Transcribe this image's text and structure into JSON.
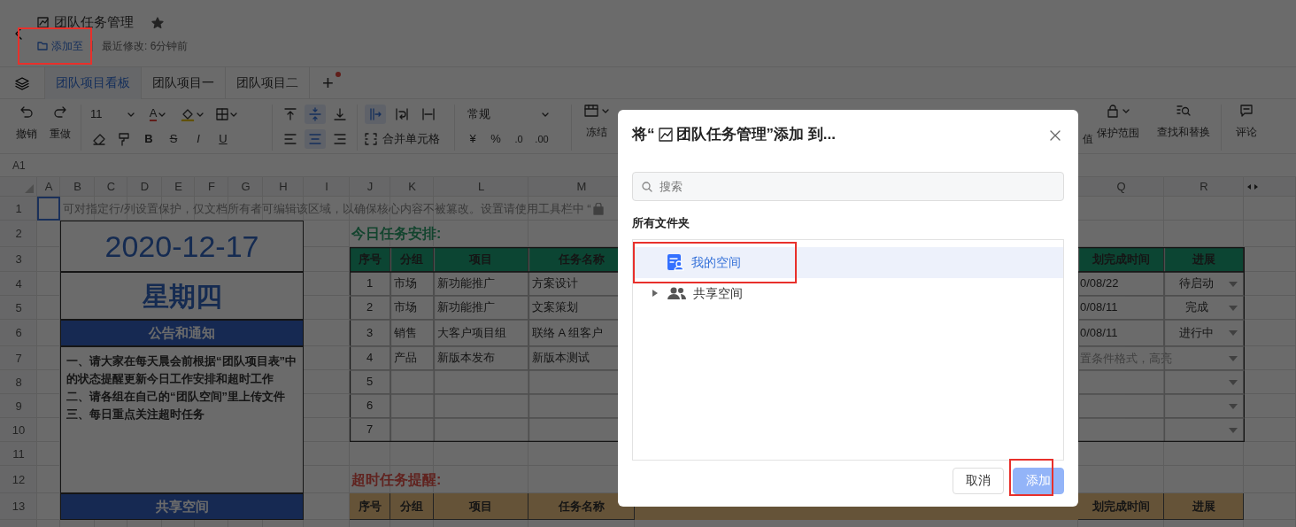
{
  "document": {
    "title": "团队任务管理",
    "starred": true,
    "add_to": {
      "label": "添加至",
      "highlighted": true
    },
    "last_modified": "最近修改: 6分钟前"
  },
  "sheet_tabs": [
    {
      "label": "团队项目看板",
      "selected": true
    },
    {
      "label": "团队项目一",
      "selected": false
    },
    {
      "label": "团队项目二",
      "selected": false
    }
  ],
  "new_tab": {
    "label": "+",
    "has_notice": true
  },
  "toolbar": {
    "undo": "撤销",
    "redo": "重做",
    "font_size": "11",
    "font_color": "A",
    "bold": "B",
    "strikethrough": "S",
    "italic": "I",
    "underline": "U",
    "align_top_on": false,
    "align_middle_on": true,
    "align_bottom_on": false,
    "align_left_on": false,
    "align_center_on": true,
    "align_right_on": false,
    "overflow_on": true,
    "wrap_on": false,
    "clip_on": false,
    "merge_cells": "合并单元格",
    "number_format": "常规",
    "currency": "¥",
    "percent": "%",
    "decrease_decimals": ".0",
    "increase_decimals": ".00",
    "freeze": "冻结",
    "value_cut": "值",
    "protect_range": "保护范围",
    "find_replace": "查找和替换",
    "comment": "评论"
  },
  "name_box": "A1",
  "columns": [
    "A",
    "B",
    "C",
    "D",
    "E",
    "F",
    "G",
    "H",
    "I",
    "J",
    "K",
    "L",
    "M",
    "Q",
    "R"
  ],
  "rows": [
    "1",
    "2",
    "3",
    "4",
    "5",
    "6",
    "7",
    "8",
    "9",
    "10",
    "11",
    "12",
    "13"
  ],
  "sheet": {
    "notice": "可对指定行/列设置保护，仅文档所有者可编辑该区域，以确保核心内容不被篡改。设置请使用工具栏中 “",
    "date": "2020-12-17",
    "weekday": "星期四",
    "announcement_heading": "公告和通知",
    "announcements": [
      "一、请大家在每天晨会前根据“团队项目表”中的状态提醒更新今日工作安排和超时工作",
      "二、请各组在自己的“团队空间”里上传文件",
      "三、每日重点关注超时任务"
    ],
    "shared_heading": "共享空间",
    "today_heading": "今日任务安排:",
    "today_table": {
      "columns": [
        "序号",
        "分组",
        "项目",
        "任务名称",
        "划完成时间",
        "进展"
      ],
      "rows": [
        {
          "no": "1",
          "group": "市场",
          "project": "新功能推广",
          "task": "方案设计",
          "planned_finish": "0/08/22",
          "progress": "待启动"
        },
        {
          "no": "2",
          "group": "市场",
          "project": "新功能推广",
          "task": "文案策划",
          "planned_finish": "0/08/11",
          "progress": "完成"
        },
        {
          "no": "3",
          "group": "销售",
          "project": "大客户项目组",
          "task": "联络 A 组客户",
          "planned_finish": "0/08/11",
          "progress": "进行中"
        },
        {
          "no": "4",
          "group": "产品",
          "project": "新版本发布",
          "task": "新版本测试",
          "planned_finish": "置条件格式，高亮"
        },
        {
          "no": "5"
        },
        {
          "no": "6"
        },
        {
          "no": "7"
        }
      ]
    },
    "overdue_heading": "超时任务提醒:",
    "overdue_table": {
      "columns": [
        "序号",
        "分组",
        "项目",
        "任务名称",
        "划完成时间",
        "进展"
      ]
    }
  },
  "dialog": {
    "title_prefix": "将“",
    "title": "团队任务管理”添加 到...",
    "search": {
      "placeholder": "搜索"
    },
    "section_label": "所有文件夹",
    "folders": [
      {
        "label": "我的空间",
        "kind": "personal",
        "selected": true,
        "highlighted": true
      },
      {
        "label": "共享空间",
        "kind": "shared",
        "selected": false,
        "expanded": false
      }
    ],
    "buttons": [
      {
        "label": "取消",
        "kind": "secondary",
        "disabled": false
      },
      {
        "label": "添加",
        "kind": "primary",
        "disabled": true,
        "highlighted": true
      }
    ]
  }
}
